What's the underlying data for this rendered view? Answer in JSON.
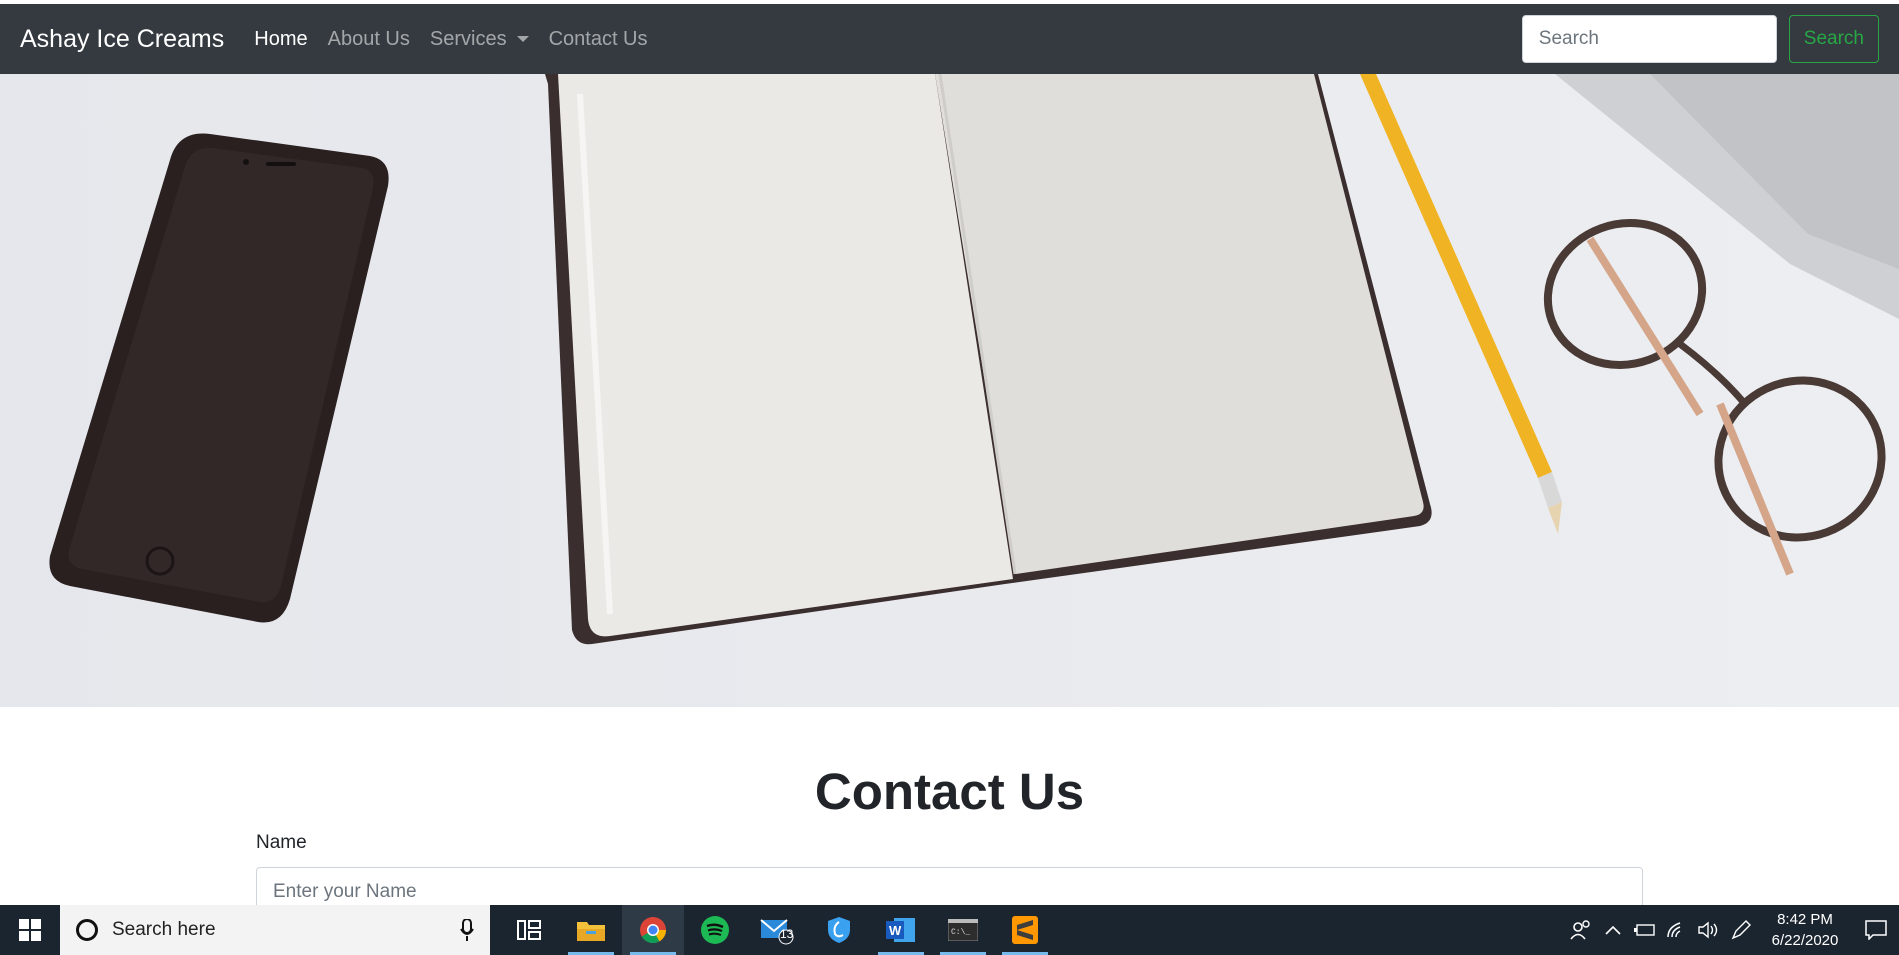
{
  "navbar": {
    "brand": "Ashay Ice Creams",
    "links": [
      "Home",
      "About Us",
      "Services",
      "Contact Us"
    ],
    "search_placeholder": "Search",
    "search_button": "Search"
  },
  "content": {
    "title": "Contact Us",
    "name_label": "Name",
    "name_placeholder": "Enter your Name"
  },
  "taskbar": {
    "search_placeholder": "Search here",
    "mail_badge": "13",
    "time": "8:42 PM",
    "date": "6/22/2020"
  },
  "colors": {
    "navbar_bg": "#343a40",
    "search_button": "#28a745",
    "taskbar_bg": "#1b2530"
  }
}
